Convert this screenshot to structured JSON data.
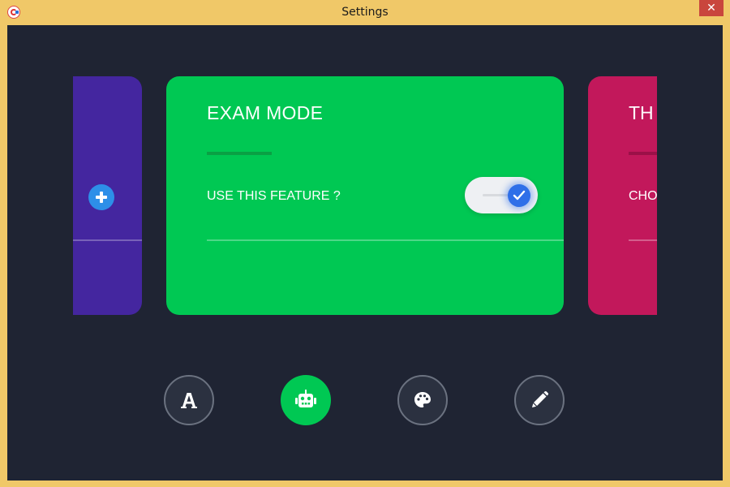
{
  "window": {
    "title": "Settings",
    "close_glyph": "✕",
    "frame_color": "#f0c868",
    "close_color": "#c9463d"
  },
  "app_icon": "app-logo-icon",
  "background_color": "#1f2433",
  "cards": {
    "left": {
      "color": "#44269f",
      "button_icon": "plus-icon"
    },
    "main": {
      "title": "EXAM MODE",
      "feature_label": "USE THIS FEATURE ?",
      "toggle_on": true,
      "color": "#00c853"
    },
    "right": {
      "title": "TH",
      "label": "CHO",
      "color": "#c2185b"
    }
  },
  "nav": {
    "items": [
      {
        "icon": "font-icon",
        "active": false
      },
      {
        "icon": "robot-icon",
        "active": true
      },
      {
        "icon": "palette-icon",
        "active": false
      },
      {
        "icon": "pencil-icon",
        "active": false
      }
    ],
    "active_color": "#00c853"
  }
}
